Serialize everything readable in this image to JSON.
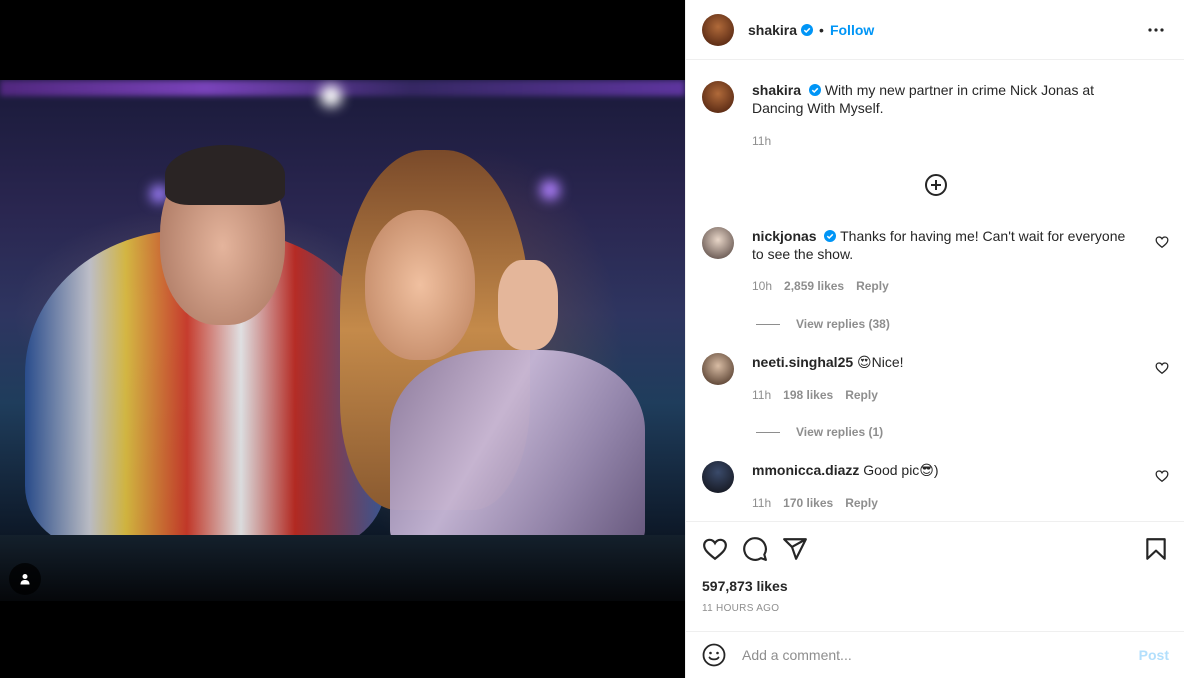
{
  "post": {
    "author": "shakira",
    "follow_label": "Follow",
    "separator": "•",
    "more_icon": "more-horizontal-icon",
    "verified_color": "#0095f6"
  },
  "caption": {
    "username": "shakira",
    "text": "With my new partner in crime Nick Jonas at Dancing With Myself.",
    "time": "11h"
  },
  "comments": [
    {
      "username": "nickjonas",
      "verified": true,
      "text": "Thanks for having me! Can't wait for everyone to see the show.",
      "time": "10h",
      "likes": "2,859 likes",
      "reply_label": "Reply",
      "view_replies": "View replies (38)"
    },
    {
      "username": "neeti.singhal25",
      "verified": false,
      "text": "😍Nice!",
      "time": "11h",
      "likes": "198 likes",
      "reply_label": "Reply",
      "view_replies": "View replies (1)"
    },
    {
      "username": "mmonicca.diazz",
      "verified": false,
      "text": "Good pic😎)",
      "time": "11h",
      "likes": "170 likes",
      "reply_label": "Reply"
    }
  ],
  "actions": {
    "likes": "597,873 likes",
    "timestamp": "11 HOURS AGO",
    "icons": [
      "heart-icon",
      "comment-icon",
      "share-icon",
      "bookmark-icon"
    ]
  },
  "composer": {
    "placeholder": "Add a comment...",
    "post_label": "Post",
    "post_color": "#b2dffc"
  }
}
